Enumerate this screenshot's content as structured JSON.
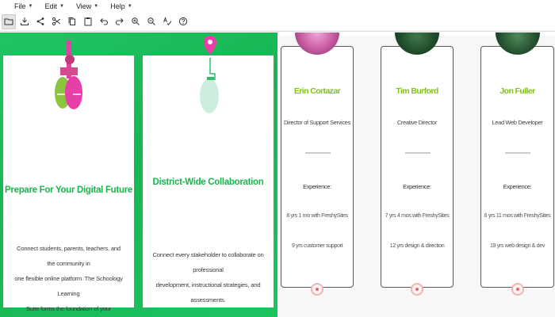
{
  "menubar": {
    "items": [
      {
        "label": "File"
      },
      {
        "label": "Edit"
      },
      {
        "label": "View"
      },
      {
        "label": "Help"
      }
    ]
  },
  "toolbar": {
    "buttons": [
      {
        "icon": "open-folder-icon",
        "active": true
      },
      {
        "icon": "download-icon"
      },
      {
        "icon": "share-icon"
      },
      {
        "icon": "cut-icon"
      },
      {
        "icon": "copy-icon"
      },
      {
        "icon": "paste-icon"
      },
      {
        "icon": "undo-icon"
      },
      {
        "icon": "redo-icon"
      },
      {
        "icon": "zoom-in-icon"
      },
      {
        "icon": "zoom-out-icon"
      },
      {
        "icon": "spellcheck-icon"
      },
      {
        "icon": "help-icon"
      }
    ]
  },
  "features": [
    {
      "title": "Prepare For Your Digital Future",
      "desc_lines": [
        "Connect students, parents, teachers, and the community in",
        "one flexible online platform. The Schoology Learning",
        "Suite forms the foundation of your connected school district."
      ]
    },
    {
      "title": "District-Wide Collaboration",
      "desc_lines": [
        "Connect every stakeholder to collaborate on professional",
        "development, instructional strategies, and assessments."
      ]
    }
  ],
  "team": [
    {
      "name": "Erin Cortazar",
      "role": "Director of Support Services",
      "experience_label": "Experience:",
      "exp1": "8 yrs 1 mo with FreshySites",
      "exp2": "9 yrs customer support"
    },
    {
      "name": "Tim Burford",
      "role": "Creative Director",
      "experience_label": "Experience:",
      "exp1": "7 yrs 4 mos with FreshySites",
      "exp2": "12 yrs design & direction"
    },
    {
      "name": "Jon Fuller",
      "role": "Lead Web Developer",
      "experience_label": "Experience:",
      "exp1": "6 yrs 11 mos with FreshySites",
      "exp2": "19 yrs web design & dev"
    }
  ],
  "colors": {
    "green_bg": "#17b653",
    "feature_title": "#19b64c",
    "person_name": "#82c11e",
    "social_accent": "#e06a6a"
  }
}
